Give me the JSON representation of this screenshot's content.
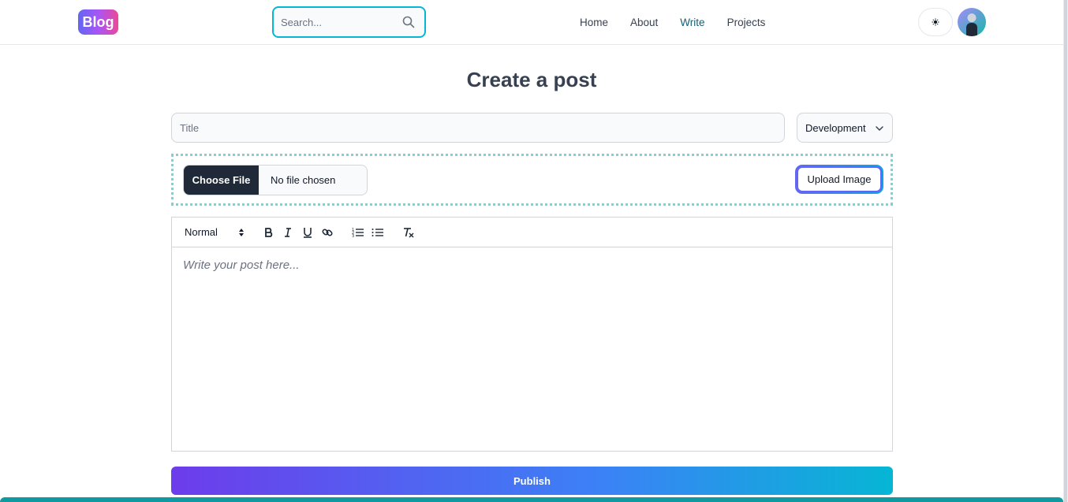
{
  "header": {
    "logo_text": "Blog",
    "search_placeholder": "Search...",
    "nav": [
      {
        "label": "Home",
        "active": false
      },
      {
        "label": "About",
        "active": false
      },
      {
        "label": "Write",
        "active": true
      },
      {
        "label": "Projects",
        "active": false
      }
    ],
    "theme_icon": "moon-icon"
  },
  "main": {
    "page_title": "Create a post",
    "title_placeholder": "Title",
    "category_value": "Development",
    "file_input": {
      "button_label": "Choose File",
      "status_text": "No file chosen"
    },
    "upload_button_label": "Upload Image",
    "editor": {
      "format_value": "Normal",
      "toolbar_icons": [
        "bold-icon",
        "italic-icon",
        "underline-icon",
        "link-icon",
        "ordered-list-icon",
        "bullet-list-icon",
        "clear-format-icon"
      ],
      "placeholder": "Write your post here..."
    },
    "publish_label": "Publish"
  },
  "colors": {
    "accent": "#06b6d4",
    "active_nav": "#155e75",
    "publish_gradient_start": "#6d3ceb",
    "publish_gradient_end": "#06b6d4"
  }
}
